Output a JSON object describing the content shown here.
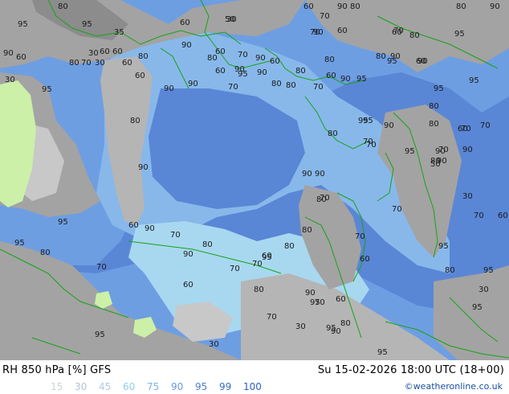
{
  "map": {
    "colors": {
      "land_gray": "#a3a3a3",
      "land_dark_gray": "#8c8c8c",
      "land_light_gray": "#c8c8c8",
      "humid_60": "#a8d8f0",
      "humid_75": "#88b8ea",
      "humid_90": "#6e9ee2",
      "humid_95": "#5a86d6",
      "dry_green": "#ccf0a8",
      "coastline": "#17a317"
    },
    "contour_labels": [
      "80",
      "95",
      "95",
      "35",
      "30",
      "60",
      "60",
      "30",
      "80",
      "95",
      "30",
      "60",
      "80",
      "90",
      "90",
      "60",
      "70",
      "90",
      "60",
      "50",
      "60",
      "70",
      "80",
      "90",
      "60",
      "60",
      "80",
      "90",
      "80",
      "90",
      "60",
      "70",
      "90",
      "80",
      "70",
      "80",
      "80",
      "30",
      "90",
      "90",
      "95",
      "70",
      "90",
      "60",
      "70",
      "60",
      "95",
      "70",
      "90",
      "60",
      "80",
      "70",
      "70",
      "95",
      "90",
      "95",
      "90",
      "80",
      "70",
      "90",
      "70",
      "80",
      "50",
      "90",
      "80",
      "80",
      "90",
      "95",
      "80",
      "90",
      "95",
      "80",
      "60",
      "95",
      "95",
      "95",
      "80",
      "70",
      "90",
      "90",
      "95",
      "70",
      "30",
      "60",
      "70",
      "80",
      "95",
      "95",
      "30",
      "70",
      "60",
      "70",
      "80",
      "80",
      "95",
      "60",
      "70",
      "90",
      "70",
      "60",
      "60",
      "70",
      "95",
      "80",
      "90",
      "60",
      "70",
      "90",
      "80",
      "60",
      "70",
      "80",
      "60",
      "95",
      "95",
      "80",
      "95",
      "90",
      "30",
      "70",
      "30",
      "95",
      "95",
      "80",
      "90"
    ]
  },
  "footer": {
    "title": "RH 850 hPa [%] GFS",
    "datetime": "Su 15-02-2026 18:00 UTC (18+00)",
    "credit": "©weatheronline.co.uk",
    "legend": [
      {
        "label": "15",
        "color": "#c9d6cc"
      },
      {
        "label": "30",
        "color": "#b4c4d2"
      },
      {
        "label": "45",
        "color": "#b8c6de"
      },
      {
        "label": "60",
        "color": "#8fcff0"
      },
      {
        "label": "75",
        "color": "#7ab2ea"
      },
      {
        "label": "90",
        "color": "#6a9be2"
      },
      {
        "label": "95",
        "color": "#4d7fd4"
      },
      {
        "label": "99",
        "color": "#3a6ccc"
      },
      {
        "label": "100",
        "color": "#2c5ec4"
      }
    ]
  }
}
